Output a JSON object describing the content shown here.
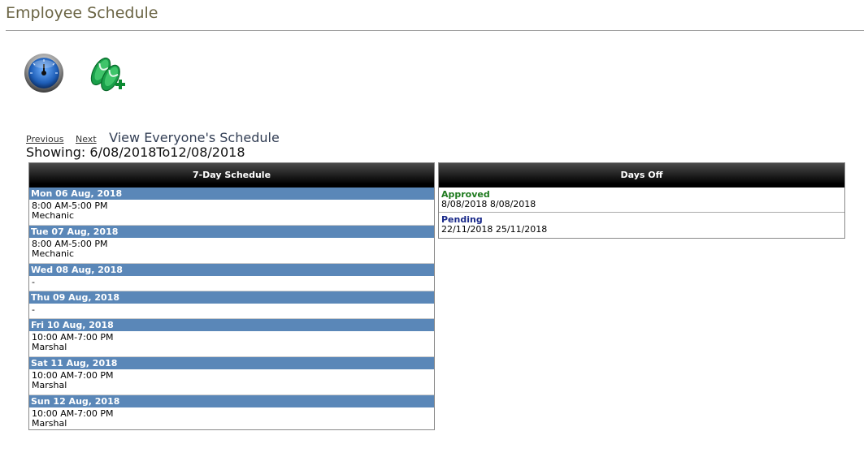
{
  "header": {
    "title": "Employee Schedule"
  },
  "toolbar": {
    "dashboard_icon": "speedometer-icon",
    "vacation_icon": "flip-flops-add-icon"
  },
  "nav": {
    "previous_label": "Previous",
    "next_label": "Next",
    "everyone_label": "View Everyone's Schedule",
    "showing_text": "Showing: 6/08/2018To12/08/2018"
  },
  "schedule": {
    "title": "7-Day Schedule",
    "days": [
      {
        "date": "Mon 06 Aug, 2018",
        "time": "8:00 AM-5:00 PM",
        "role": "Mechanic"
      },
      {
        "date": "Tue 07 Aug, 2018",
        "time": "8:00 AM-5:00 PM",
        "role": "Mechanic"
      },
      {
        "date": "Wed 08 Aug, 2018",
        "time": "-",
        "role": ""
      },
      {
        "date": "Thu 09 Aug, 2018",
        "time": "-",
        "role": ""
      },
      {
        "date": "Fri 10 Aug, 2018",
        "time": "10:00 AM-7:00 PM",
        "role": "Marshal"
      },
      {
        "date": "Sat 11 Aug, 2018",
        "time": "10:00 AM-7:00 PM",
        "role": "Marshal"
      },
      {
        "date": "Sun 12 Aug, 2018",
        "time": "10:00 AM-7:00 PM",
        "role": "Marshal"
      }
    ]
  },
  "days_off": {
    "title": "Days Off",
    "items": [
      {
        "status": "Approved",
        "dates": "8/08/2018 8/08/2018",
        "color": "#1e7a1e"
      },
      {
        "status": "Pending",
        "dates": "22/11/2018 25/11/2018",
        "color": "#1a2a8a"
      }
    ]
  }
}
